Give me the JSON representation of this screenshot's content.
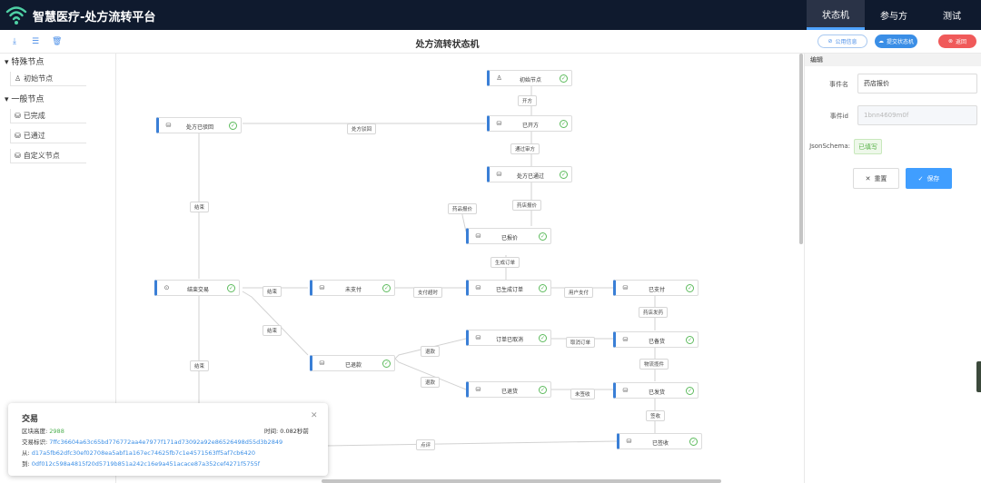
{
  "app": {
    "title": "智慧医疗-处方流转平台"
  },
  "nav": {
    "tabs": [
      {
        "label": "状态机",
        "active": true
      },
      {
        "label": "参与方",
        "active": false
      },
      {
        "label": "测试",
        "active": false
      }
    ]
  },
  "toolbar": {
    "title": "处方流转状态机",
    "public_label": "公用信息",
    "submit_label": "提交状态机",
    "back_label": "返回"
  },
  "sidebar": {
    "special_title": "特殊节点",
    "special_items": [
      {
        "label": "初始节点"
      }
    ],
    "general_title": "一般节点",
    "general_items": [
      {
        "label": "已完成"
      },
      {
        "label": "已通过"
      },
      {
        "label": "自定义节点"
      }
    ]
  },
  "graph": {
    "nodes": {
      "initial": "初始节点",
      "opened": "已开方",
      "rejected": "处方已驳回",
      "approved": "处方已通过",
      "quoted": "已报价",
      "end": "结束交易",
      "unpaid": "未支付",
      "ordered": "已生成订单",
      "paid": "已支付",
      "refunded": "已退款",
      "cancelled": "订单已取消",
      "stocked": "已备货",
      "returned": "已退货",
      "shipped": "已发货",
      "received": "已签收"
    },
    "edges": {
      "open": "开方",
      "reject": "处方驳回",
      "approve": "通过审方",
      "pharmacy_quote": "药店报价",
      "drug_quote": "药品报价",
      "generate_order": "生成订单",
      "pay_timeout": "支付超时",
      "user_pay": "用户支付",
      "end1": "结束",
      "end2": "结束",
      "end3": "结束",
      "end4": "结束",
      "pharmacy_stock": "药店发药",
      "cancel_order": "取消订单",
      "refund1": "退款",
      "refund2": "退款",
      "logistics": "物流揽件",
      "not_received": "未签收",
      "sign": "签收",
      "review": "点评"
    }
  },
  "panel": {
    "header": "编辑",
    "event_name_label": "事件名",
    "event_name_value": "药店报价",
    "event_id_label": "事件id",
    "event_id_value": "1bnn4609m0f",
    "schema_label": "JsonSchema:",
    "schema_value": "已填写",
    "reset_label": "重置",
    "save_label": "保存"
  },
  "popup": {
    "title": "交易",
    "height_key": "区块高度:",
    "height_value": "2988",
    "time_key": "时间:",
    "time_value": "0.082秒前",
    "tx_key": "交易标识:",
    "tx_value": "7ffc36604a63c65bd776772aa4e7977f171ad73092a92e86526498d55d3b2849",
    "from_key": "从:",
    "from_value": "d17a5fb62dfc30ef02708ea5abf1a167ec74625fb7c1e4571563ff5af7cb6420",
    "to_key": "到:",
    "to_value": "0df012c598a4815f20d5719b851a242c16e9a451acace87a352cef4271f5755f"
  },
  "colors": {
    "topbar": "#0f1a2e",
    "accent": "#3a8ee6",
    "node_bar": "#3a7fd6",
    "ok": "#5dbb5d",
    "danger": "#f05a5a"
  }
}
